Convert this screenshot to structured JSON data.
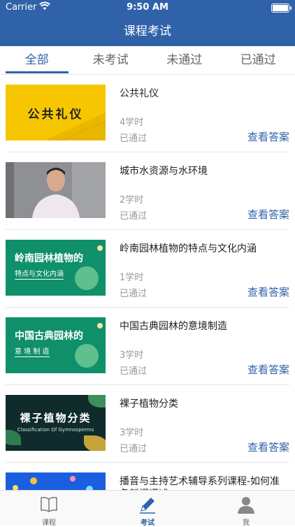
{
  "status_bar": {
    "carrier": "Carrier",
    "time": "9:50 AM"
  },
  "header": {
    "title": "课程考试"
  },
  "tabs": [
    {
      "label": "全部",
      "active": true
    },
    {
      "label": "未考试",
      "active": false
    },
    {
      "label": "未通过",
      "active": false
    },
    {
      "label": "已通过",
      "active": false
    }
  ],
  "courses": [
    {
      "title": "公共礼仪",
      "hours": "4学时",
      "status": "已通过",
      "action": "查看答案",
      "thumb_text": "公共礼仪"
    },
    {
      "title": "城市水资源与水环境",
      "hours": "2学时",
      "status": "已通过",
      "action": "查看答案"
    },
    {
      "title": "岭南园林植物的特点与文化内涵",
      "hours": "1学时",
      "status": "已通过",
      "action": "查看答案",
      "thumb_text": "岭南园林植物的",
      "thumb_sub": "特点与文化内涵"
    },
    {
      "title": "中国古典园林的意境制造",
      "hours": "3学时",
      "status": "已通过",
      "action": "查看答案",
      "thumb_text": "中国古典园林的",
      "thumb_sub": "意 境 制 造"
    },
    {
      "title": "裸子植物分类",
      "hours": "3学时",
      "status": "已通过",
      "action": "查看答案",
      "thumb_text": "裸子植物分类",
      "thumb_sub": "Classification Of Gymnosperms"
    },
    {
      "title": "播音与主持艺术辅导系列课程-如何准备新闻评述"
    }
  ],
  "tabbar": [
    {
      "label": "课程",
      "icon": "book-icon",
      "active": false
    },
    {
      "label": "考试",
      "icon": "pencil-icon",
      "active": true
    },
    {
      "label": "我",
      "icon": "person-icon",
      "active": false
    }
  ],
  "colors": {
    "primary": "#2f62a8",
    "muted": "#999999"
  }
}
